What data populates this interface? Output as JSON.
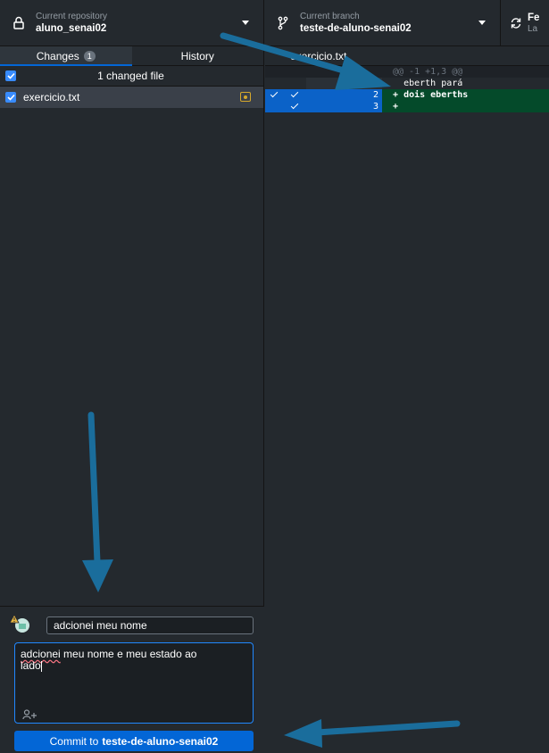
{
  "repo": {
    "label": "Current repository",
    "value": "aluno_senai02"
  },
  "branch": {
    "label": "Current branch",
    "value": "teste-de-aluno-senai02"
  },
  "fetch": {
    "label": "Fe",
    "sub": "La"
  },
  "tabs": [
    {
      "label": "Changes",
      "badge": "1"
    },
    {
      "label": "History"
    }
  ],
  "changes": {
    "summary": "1 changed file",
    "files": [
      {
        "name": "exercicio.txt",
        "status": "modified"
      }
    ]
  },
  "diff": {
    "file": "exercicio.txt",
    "hunk": "@@ -1 +1,3 @@",
    "lines": [
      {
        "old": "1",
        "new": "1",
        "prefix": " ",
        "text": "eberth pará",
        "type": "context"
      },
      {
        "old": "",
        "new": "2",
        "prefix": "+",
        "text": "dois eberths",
        "type": "added"
      },
      {
        "old": "",
        "new": "3",
        "prefix": "+",
        "text": "",
        "type": "added"
      }
    ]
  },
  "commit": {
    "summary": "adcionei meu nome",
    "description_word1": "adcionei",
    "description_rest1": " meu nome e meu estado ao",
    "description_line2": "lado",
    "button_prefix": "Commit to",
    "button_branch": "teste-de-aluno-senai02"
  },
  "colors": {
    "accent": "#0366d6",
    "arrow": "#1a6d9c",
    "added_bg": "#044a2a"
  }
}
